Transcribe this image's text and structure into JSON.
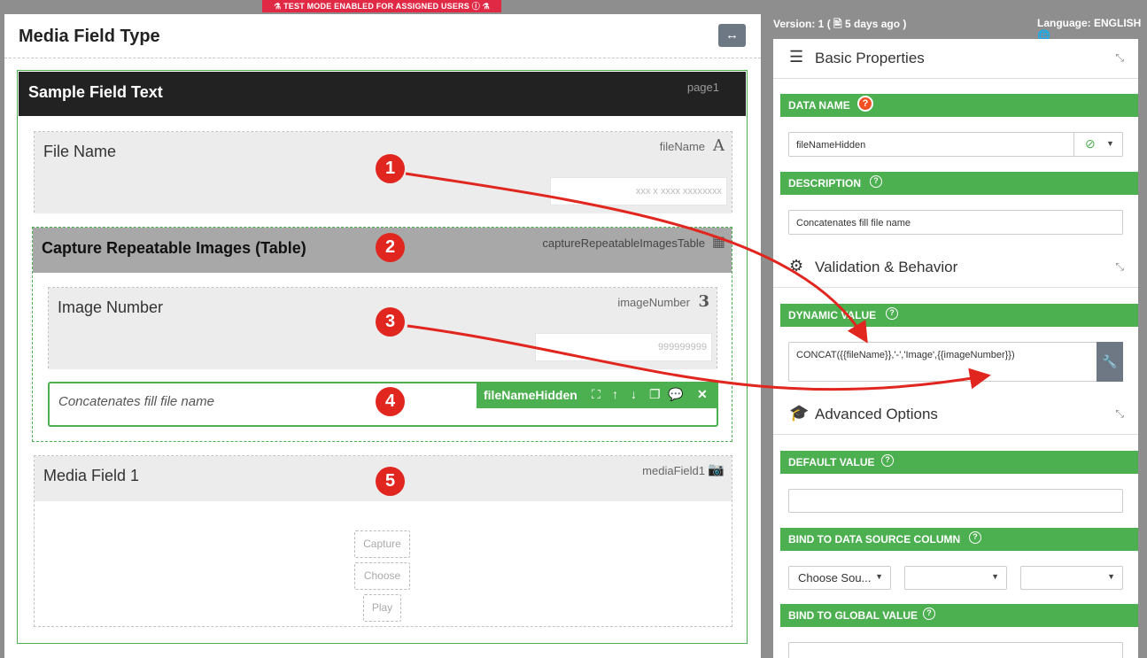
{
  "banner": "TEST MODE ENABLED FOR ASSIGNED USERS",
  "form": {
    "title": "Media Field Type",
    "page_title": "Sample Field Text",
    "page_key": "page1"
  },
  "fields": {
    "file_name": {
      "label": "File Name",
      "key": "fileName",
      "icon": "A",
      "mask": "xxx x xxxx xxxxxxxx"
    },
    "capture_table": {
      "label": "Capture Repeatable Images (Table)",
      "key": "captureRepeatableImagesTable"
    },
    "image_number": {
      "label": "Image Number",
      "key": "imageNumber",
      "icon": "3",
      "mask": "999999999"
    },
    "file_name_hidden": {
      "text": "Concatenates fill file name",
      "toolbar_name": "fileNameHidden"
    },
    "media_field": {
      "label": "Media Field 1",
      "key": "mediaField1",
      "capture": "Capture",
      "choose": "Choose",
      "play": "Play"
    }
  },
  "badges": [
    "1",
    "2",
    "3",
    "4",
    "5"
  ],
  "meta": {
    "version": "Version: 1 ( 🖹 5 days ago )",
    "language": "Language: ENGLISH"
  },
  "properties": {
    "basic_title": "Basic Properties",
    "data_name_label": "DATA NAME",
    "data_name_value": "fileNameHidden",
    "description_label": "DESCRIPTION",
    "description_value": "Concatenates fill file name",
    "validation_title": "Validation & Behavior",
    "dynamic_value_label": "DYNAMIC VALUE",
    "dynamic_value": "CONCAT({{fileName}},'-','Image',{{imageNumber}})",
    "advanced_title": "Advanced Options",
    "default_value_label": "DEFAULT VALUE",
    "default_value": "",
    "bind_source_label": "BIND TO DATA SOURCE COLUMN",
    "bind_source_select": "Choose Sou...",
    "bind_global_label": "BIND TO GLOBAL VALUE"
  },
  "colors": {
    "accent_green": "#4caf50",
    "banner_red": "#e02a45",
    "badge_red": "#e0261f",
    "dark_header": "#222222"
  }
}
